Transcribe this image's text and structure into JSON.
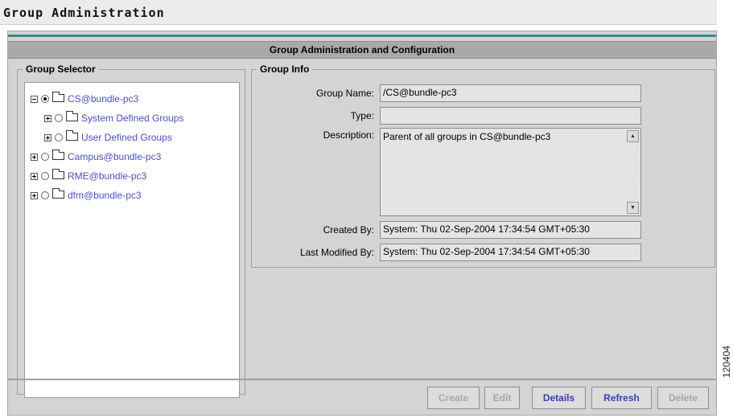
{
  "page": {
    "title": "Group Administration"
  },
  "banner": {
    "title": "Group Administration and Configuration"
  },
  "group_selector": {
    "legend": "Group Selector",
    "tree": [
      {
        "label": "CS@bundle-pc3",
        "expander": "minus",
        "selected": true,
        "open_folder": true
      },
      {
        "label": "System Defined Groups",
        "expander": "plus",
        "selected": false
      },
      {
        "label": "User Defined Groups",
        "expander": "plus",
        "selected": false
      },
      {
        "label": "Campus@bundle-pc3",
        "expander": "plus",
        "selected": false
      },
      {
        "label": "RME@bundle-pc3",
        "expander": "plus",
        "selected": false
      },
      {
        "label": "dfm@bundle-pc3",
        "expander": "plus",
        "selected": false
      }
    ]
  },
  "group_info": {
    "legend": "Group Info",
    "name_label": "Group Name:",
    "name_value": "/CS@bundle-pc3",
    "type_label": "Type:",
    "type_value": "",
    "description_label": "Description:",
    "description_value": "Parent of all groups in CS@bundle-pc3",
    "created_by_label": "Created By:",
    "created_by_value": "System: Thu 02-Sep-2004 17:34:54 GMT+05:30",
    "modified_by_label": "Last Modified By:",
    "modified_by_value": "System: Thu 02-Sep-2004 17:34:54 GMT+05:30"
  },
  "buttons": {
    "create": "Create",
    "edit": "Edit",
    "details": "Details",
    "refresh": "Refresh",
    "delete": "Delete"
  },
  "colors": {
    "tree_link": "#4a4fd0",
    "teal_line": "#338a8a",
    "active_button_text": "#3a3fb5",
    "disabled_button_text": "#a8a8a8"
  },
  "figure_number": "120404"
}
